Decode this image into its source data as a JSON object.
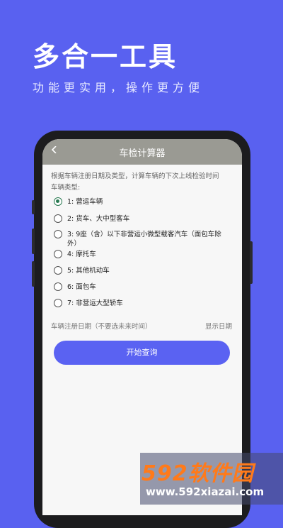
{
  "hero": {
    "title": "多合一工具",
    "subtitle": "功能更实用，操作更方便"
  },
  "app": {
    "title": "车检计算器",
    "back_icon": "chevron-left-icon",
    "description": "根据车辆注册日期及类型，计算车辆的下次上线检验时间",
    "type_label": "车辆类型:",
    "options": [
      {
        "label": "1: 营运车辆",
        "selected": true
      },
      {
        "label": "2: 货车、大中型客车",
        "selected": false
      },
      {
        "label": "3: 9座（含）以下非营运小微型载客汽车（面包车除外）",
        "selected": false
      },
      {
        "label": "4: 摩托车",
        "selected": false
      },
      {
        "label": "5: 其他机动车",
        "selected": false
      },
      {
        "label": "6: 面包车",
        "selected": false
      },
      {
        "label": "7: 非营运大型轿车",
        "selected": false
      }
    ],
    "date_label": "车辆注册日期（不要选未来时间）",
    "date_value": "显示日期",
    "query_button": "开始查询"
  },
  "watermark": {
    "logo": "592软件园",
    "url": "www.592xiazai.com"
  },
  "colors": {
    "background": "#5961f0",
    "accent_button": "#5a62f2",
    "topbar": "#9a9a93",
    "radio_selected": "#2a7a52",
    "watermark_logo": "#ff7a1a"
  }
}
